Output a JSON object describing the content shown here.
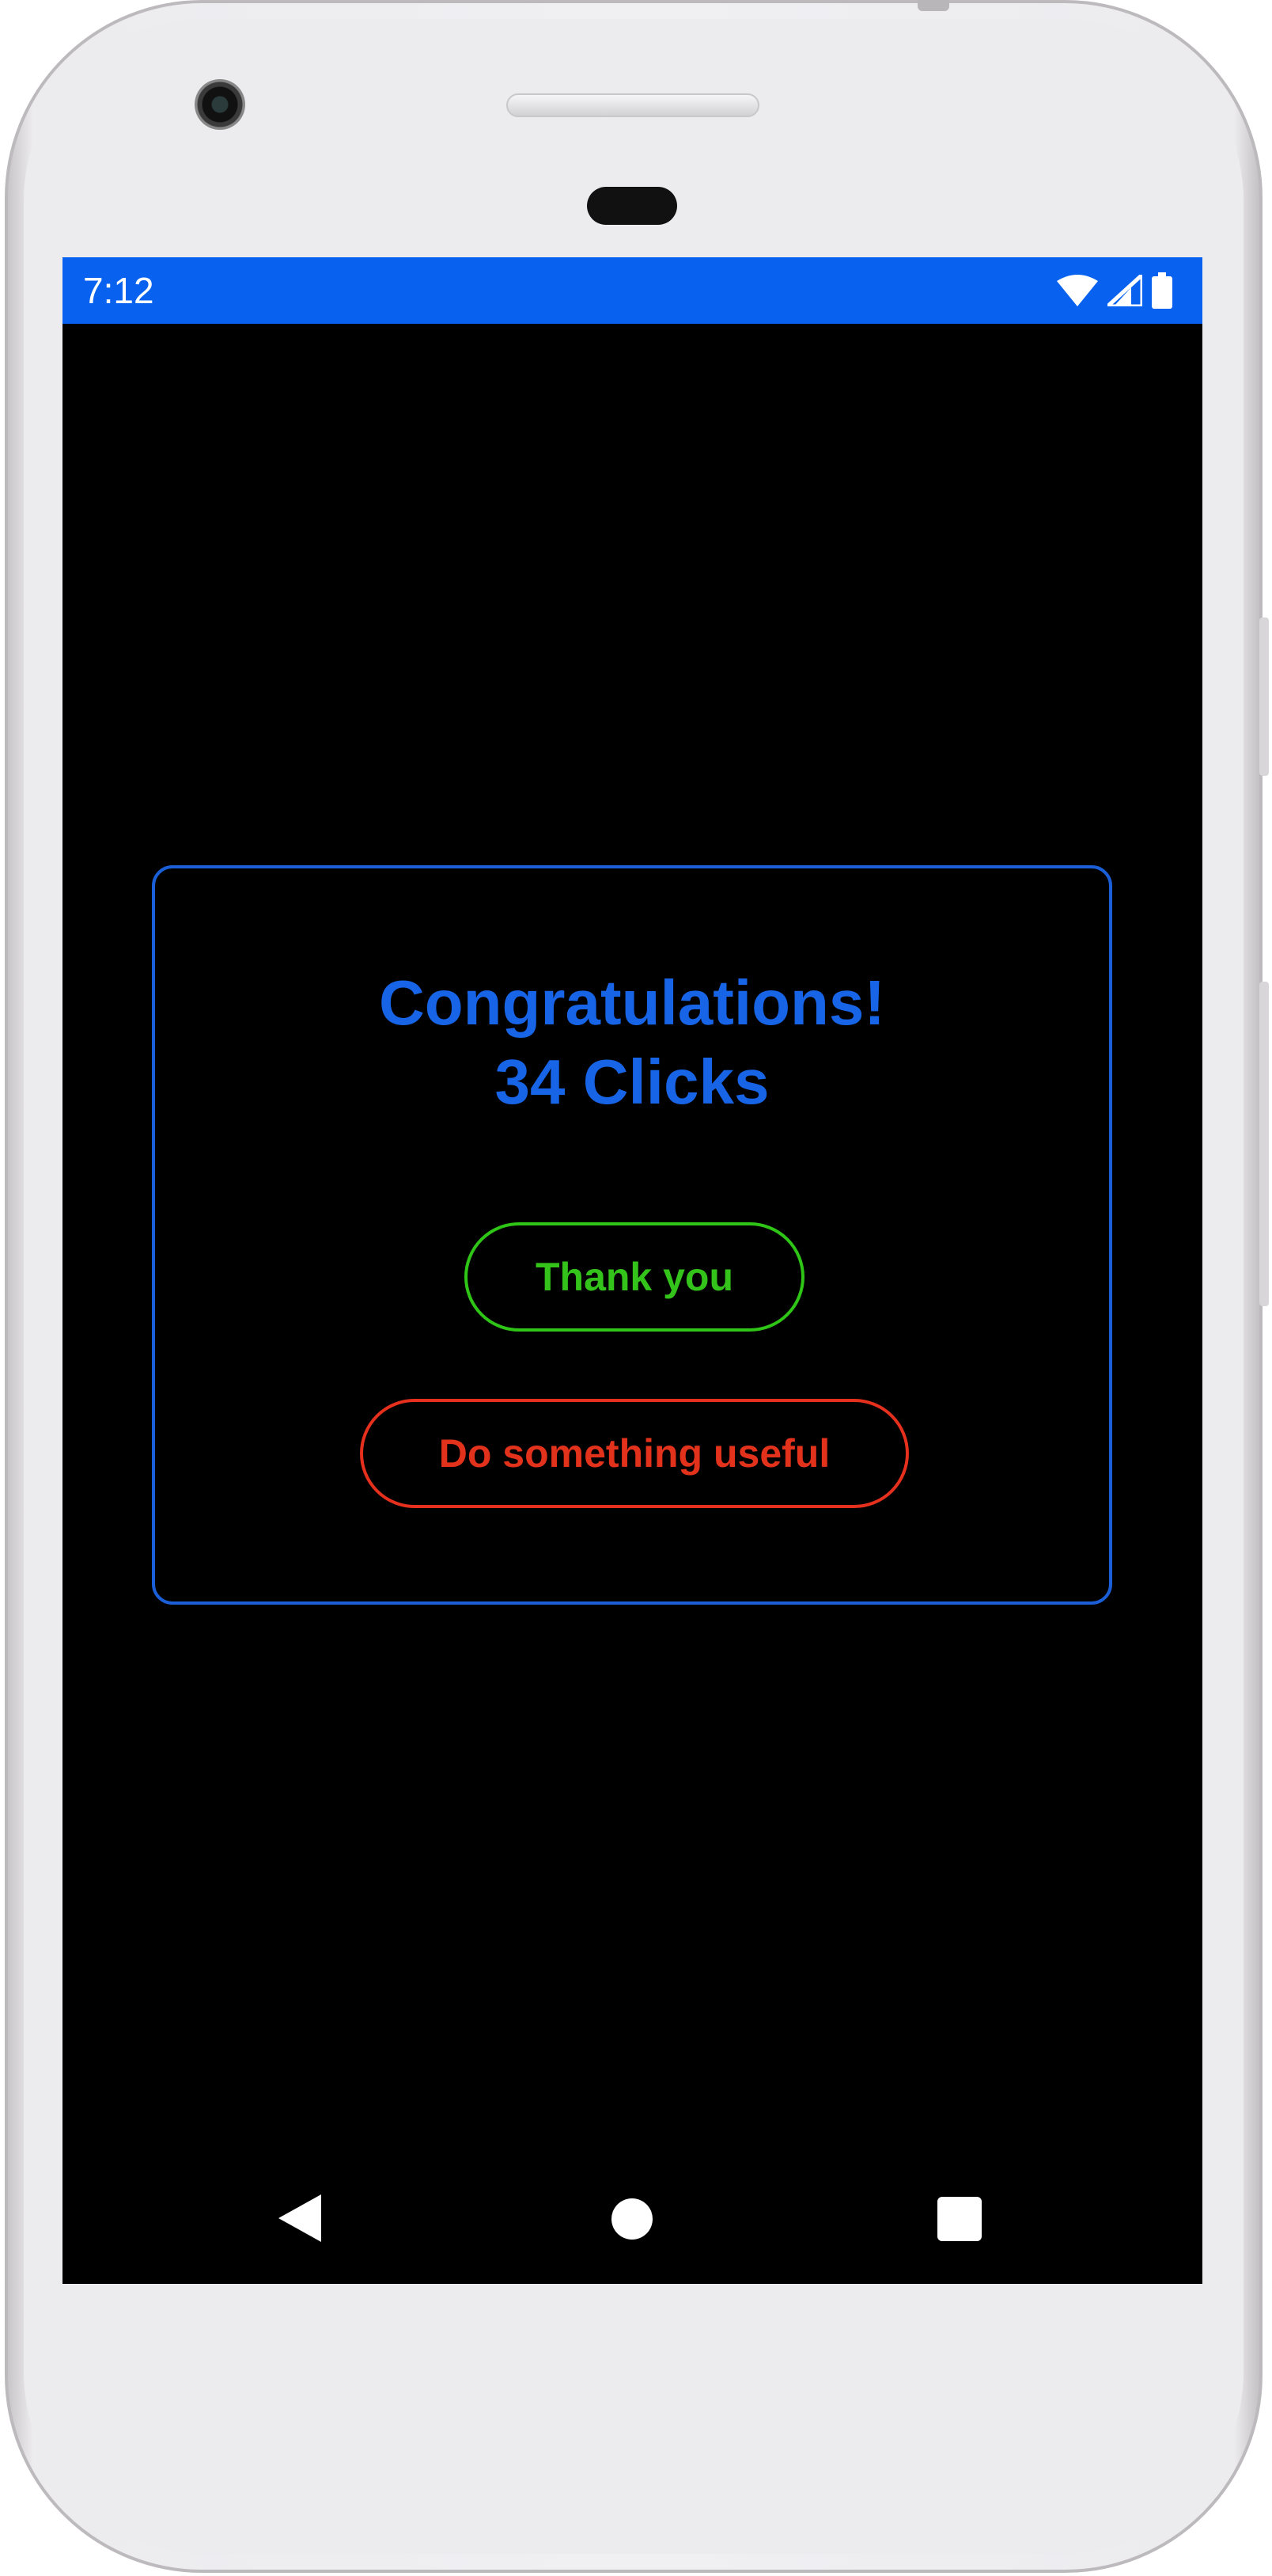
{
  "status_bar": {
    "time": "7:12",
    "background_color": "#0862EF",
    "icons": [
      "wifi-icon",
      "cellular-signal-icon",
      "battery-icon"
    ]
  },
  "dialog": {
    "title_line1": "Congratulations!",
    "title_line2": "34 Clicks",
    "border_color": "#1A5FD8",
    "title_color": "#1764E6"
  },
  "buttons": {
    "thank_you": {
      "label": "Thank you",
      "color": "#33C31A"
    },
    "do_something_useful": {
      "label": "Do something useful",
      "color": "#E3321C"
    }
  },
  "navigation_bar": {
    "icons": [
      "back-icon",
      "home-icon",
      "recents-icon"
    ]
  }
}
